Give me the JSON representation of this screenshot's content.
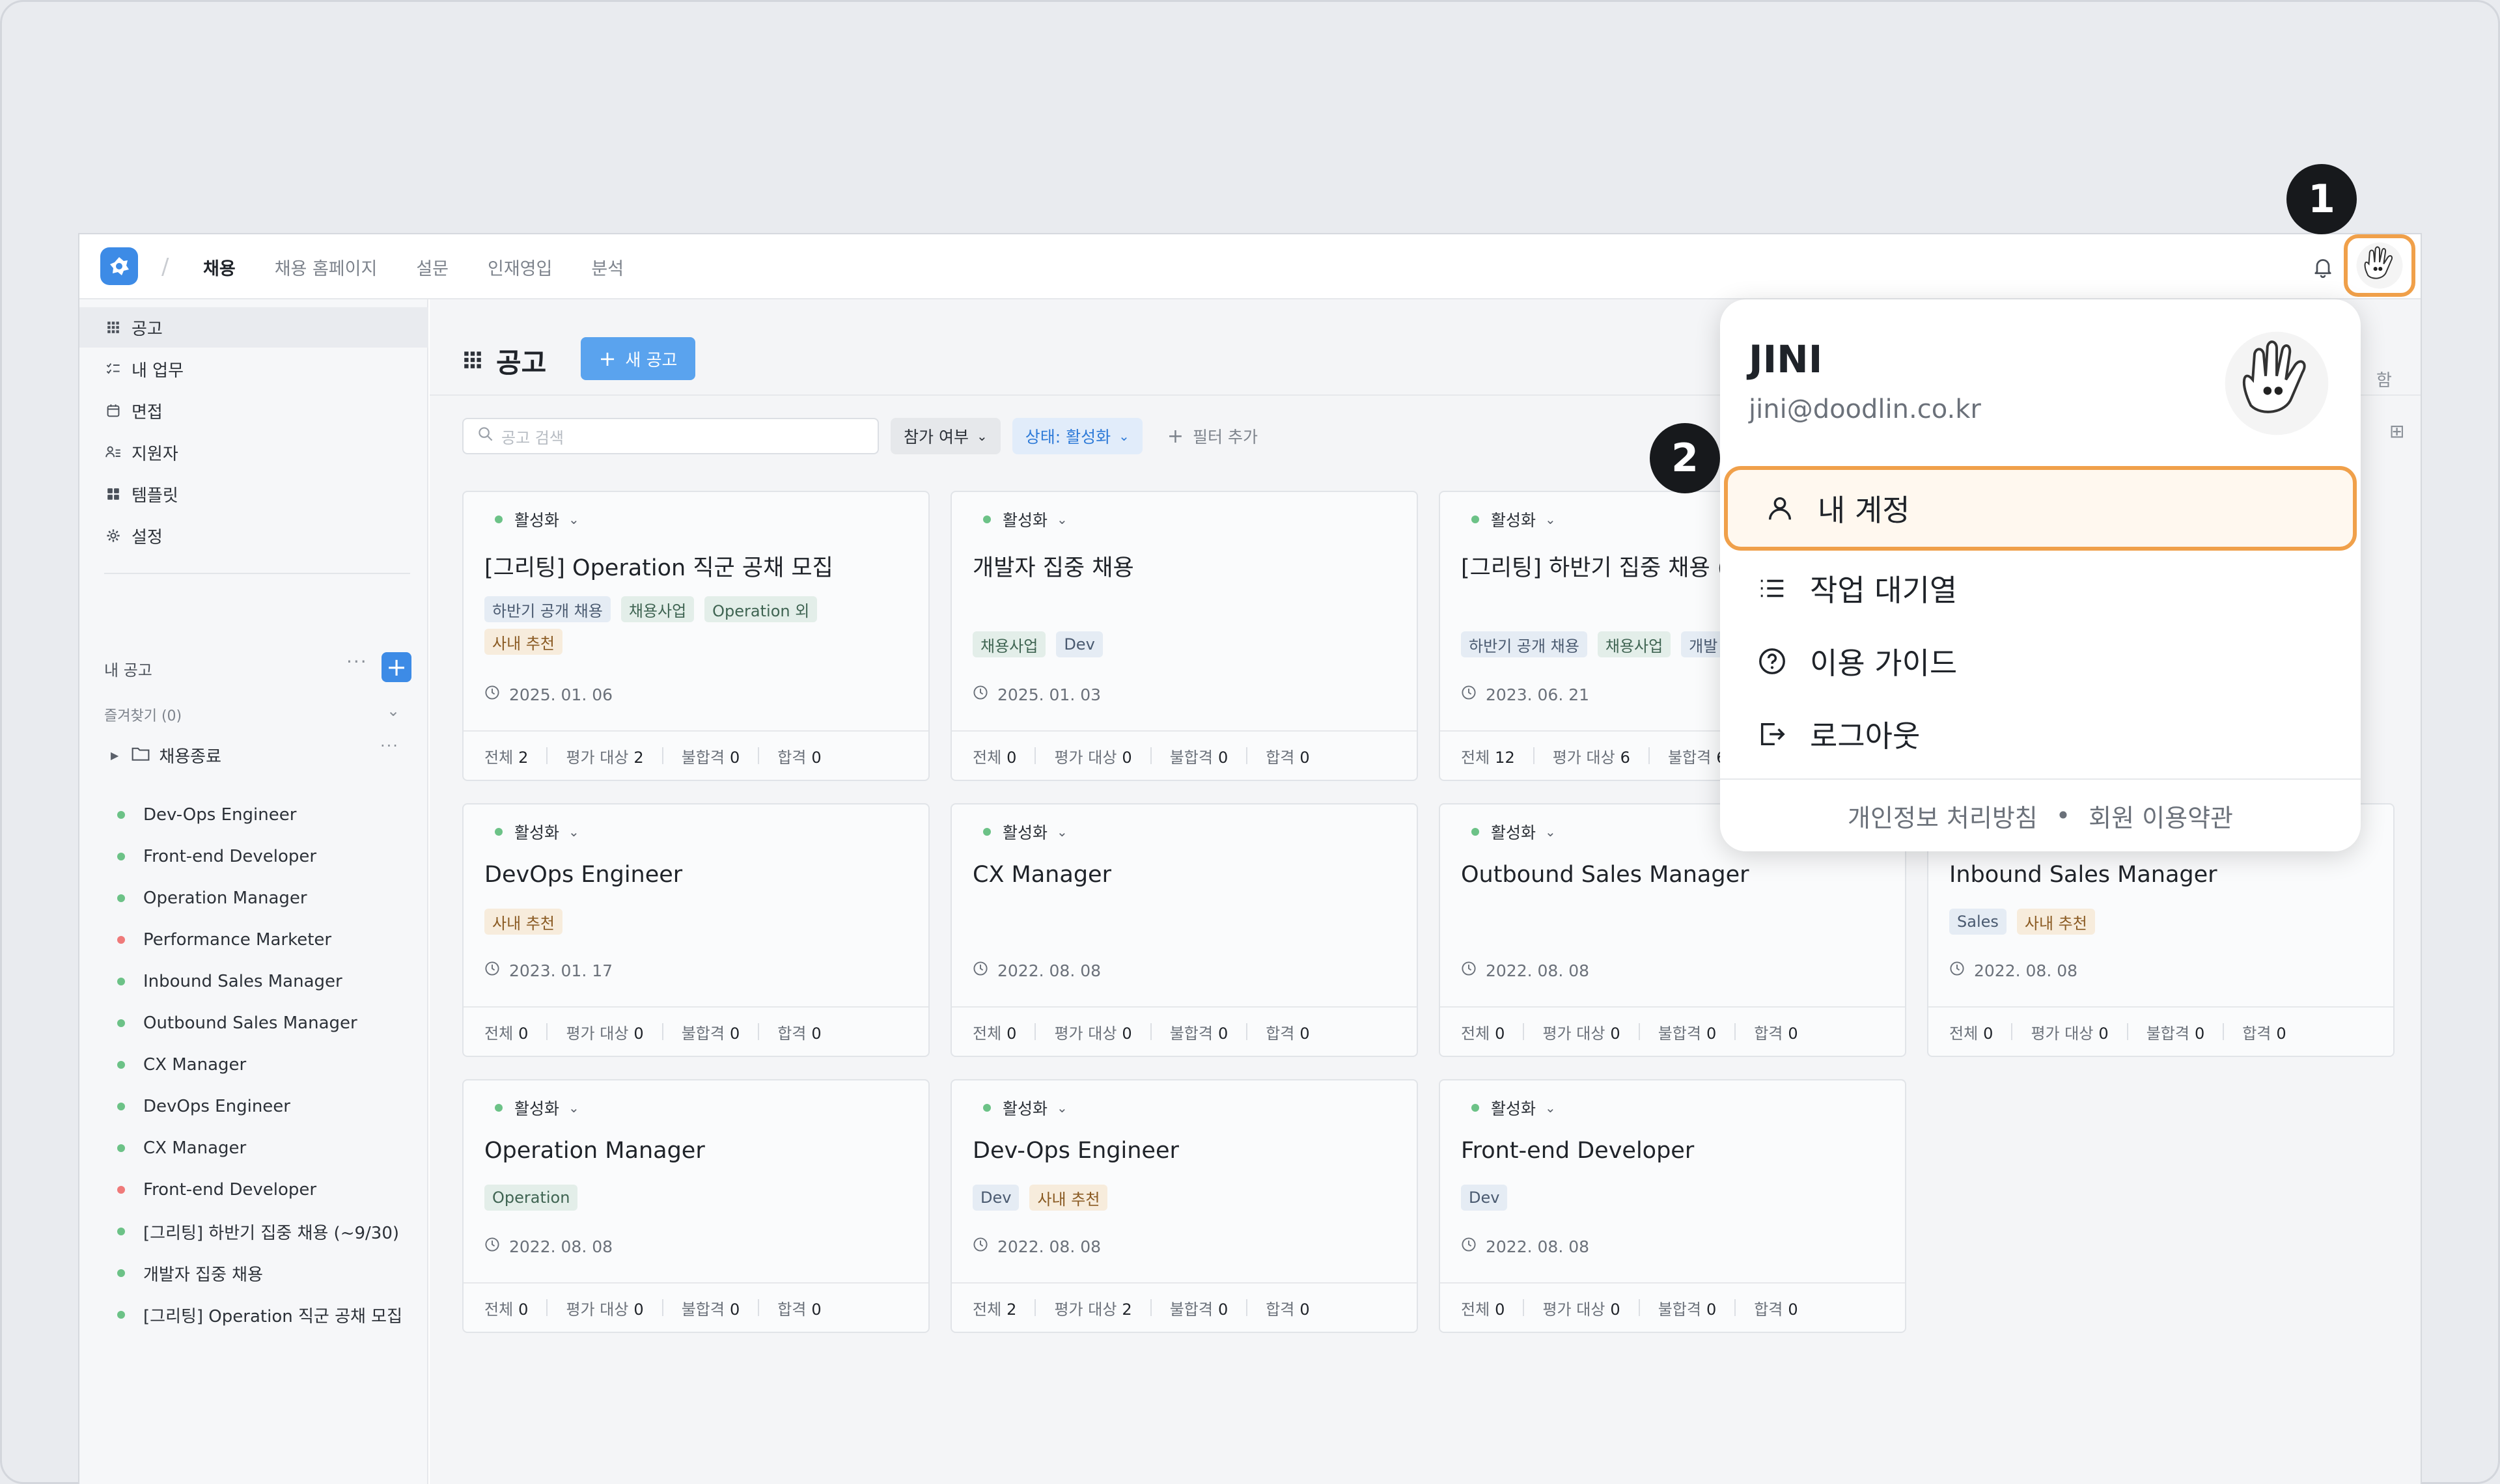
{
  "nav": {
    "items": [
      "채용",
      "채용 홈페이지",
      "설문",
      "인재영입",
      "분석"
    ]
  },
  "sidebar": {
    "menu": [
      {
        "label": "공고",
        "icon": "grid-icon"
      },
      {
        "label": "내 업무",
        "icon": "checklist-icon"
      },
      {
        "label": "면접",
        "icon": "calendar-icon"
      },
      {
        "label": "지원자",
        "icon": "people-icon"
      },
      {
        "label": "템플릿",
        "icon": "template-icon"
      },
      {
        "label": "설정",
        "icon": "gear-icon"
      }
    ],
    "my_jobs_label": "내 공고",
    "favorites_label": "즐겨찾기 (0)",
    "folder_label": "채용종료",
    "jobs": [
      {
        "label": "Dev-Ops Engineer",
        "color": "#6cc287"
      },
      {
        "label": "Front-end Developer",
        "color": "#6cc287"
      },
      {
        "label": "Operation Manager",
        "color": "#6cc287"
      },
      {
        "label": "Performance Marketer",
        "color": "#ef7a7a"
      },
      {
        "label": "Inbound Sales Manager",
        "color": "#6cc287"
      },
      {
        "label": "Outbound Sales Manager",
        "color": "#6cc287"
      },
      {
        "label": "CX Manager",
        "color": "#6cc287"
      },
      {
        "label": "DevOps Engineer",
        "color": "#6cc287"
      },
      {
        "label": "CX Manager",
        "color": "#6cc287"
      },
      {
        "label": "Front-end Developer",
        "color": "#ef7a7a"
      },
      {
        "label": "[그리팅] 하반기 집중 채용 (~9/30)",
        "color": "#6cc287"
      },
      {
        "label": "개발자 집중 채용",
        "color": "#6cc287"
      },
      {
        "label": "[그리팅] Operation 직군 공채 모집",
        "color": "#6cc287"
      }
    ]
  },
  "main": {
    "title": "공고",
    "new_button": "새 공고",
    "search_placeholder": "공고 검색",
    "filter_participation": "참가 여부",
    "filter_status": "상태: 활성화",
    "filter_add": "필터 추가",
    "right_partial": "함"
  },
  "stat_labels": {
    "total": "전체",
    "eval": "평가 대상",
    "fail": "불합격",
    "pass": "합격"
  },
  "cards": [
    {
      "status": "활성화",
      "title": "[그리팅] Operation 직군 공채 모집",
      "tags": [
        {
          "t": "하반기 공개 채용",
          "c": "t-blue"
        },
        {
          "t": "채용사업",
          "c": "t-green"
        },
        {
          "t": "Operation 외",
          "c": "t-green"
        },
        {
          "t": "사내 추천",
          "c": "t-orange"
        }
      ],
      "date": "2025. 01. 06",
      "total": "2",
      "eval": "2",
      "fail": "0",
      "pass": "0"
    },
    {
      "status": "활성화",
      "title": "개발자 집중 채용",
      "tags": [
        {
          "t": "채용사업",
          "c": "t-green"
        },
        {
          "t": "Dev",
          "c": "t-blue"
        }
      ],
      "date": "2025. 01. 03",
      "total": "0",
      "eval": "0",
      "fail": "0",
      "pass": "0"
    },
    {
      "status": "활성화",
      "title": "[그리팅] 하반기 집중 채용 (~",
      "tags": [
        {
          "t": "하반기 공개 채용",
          "c": "t-blue"
        },
        {
          "t": "채용사업",
          "c": "t-green"
        },
        {
          "t": "개발",
          "c": "t-blue"
        }
      ],
      "date": "2023. 06. 21",
      "total": "12",
      "eval": "6",
      "fail": "6",
      "pass": ""
    },
    {
      "status": "활성화",
      "title": "DevOps Engineer",
      "tags": [
        {
          "t": "사내 추천",
          "c": "t-orange"
        }
      ],
      "date": "2023. 01. 17",
      "total": "0",
      "eval": "0",
      "fail": "0",
      "pass": "0"
    },
    {
      "status": "활성화",
      "title": "CX Manager",
      "tags": [],
      "date": "2022. 08. 08",
      "total": "0",
      "eval": "0",
      "fail": "0",
      "pass": "0"
    },
    {
      "status": "활성화",
      "title": "Outbound Sales Manager",
      "tags": [],
      "date": "2022. 08. 08",
      "total": "0",
      "eval": "0",
      "fail": "0",
      "pass": "0"
    },
    {
      "status": "활성화",
      "title": "Inbound Sales Manager",
      "tags": [
        {
          "t": "Sales",
          "c": "t-blue"
        },
        {
          "t": "사내 추천",
          "c": "t-orange"
        }
      ],
      "date": "2022. 08. 08",
      "total": "0",
      "eval": "0",
      "fail": "0",
      "pass": "0"
    },
    {
      "status": "활성화",
      "title": "Operation Manager",
      "tags": [
        {
          "t": "Operation",
          "c": "t-green"
        }
      ],
      "date": "2022. 08. 08",
      "total": "0",
      "eval": "0",
      "fail": "0",
      "pass": "0"
    },
    {
      "status": "활성화",
      "title": "Dev-Ops Engineer",
      "tags": [
        {
          "t": "Dev",
          "c": "t-blue"
        },
        {
          "t": "사내 추천",
          "c": "t-orange"
        }
      ],
      "date": "2022. 08. 08",
      "total": "2",
      "eval": "2",
      "fail": "0",
      "pass": "0"
    },
    {
      "status": "활성화",
      "title": "Front-end Developer",
      "tags": [
        {
          "t": "Dev",
          "c": "t-blue"
        }
      ],
      "date": "2022. 08. 08",
      "total": "0",
      "eval": "0",
      "fail": "0",
      "pass": "0"
    }
  ],
  "dropdown": {
    "name": "JINI",
    "email": "jini@doodlin.co.kr",
    "items": [
      {
        "label": "내 계정",
        "icon": "user-icon"
      },
      {
        "label": "작업 대기열",
        "icon": "list-icon"
      },
      {
        "label": "이용 가이드",
        "icon": "help-circle-icon"
      },
      {
        "label": "로그아웃",
        "icon": "logout-icon"
      }
    ],
    "footer_privacy": "개인정보 처리방침",
    "footer_dot": "•",
    "footer_terms": "회원 이용약관"
  },
  "badges": [
    "1",
    "2"
  ],
  "colors": {
    "accent": "#3d8be6",
    "highlight": "#f0a04a",
    "active_dot": "#6cc287",
    "inactive_dot": "#ef7a7a"
  }
}
